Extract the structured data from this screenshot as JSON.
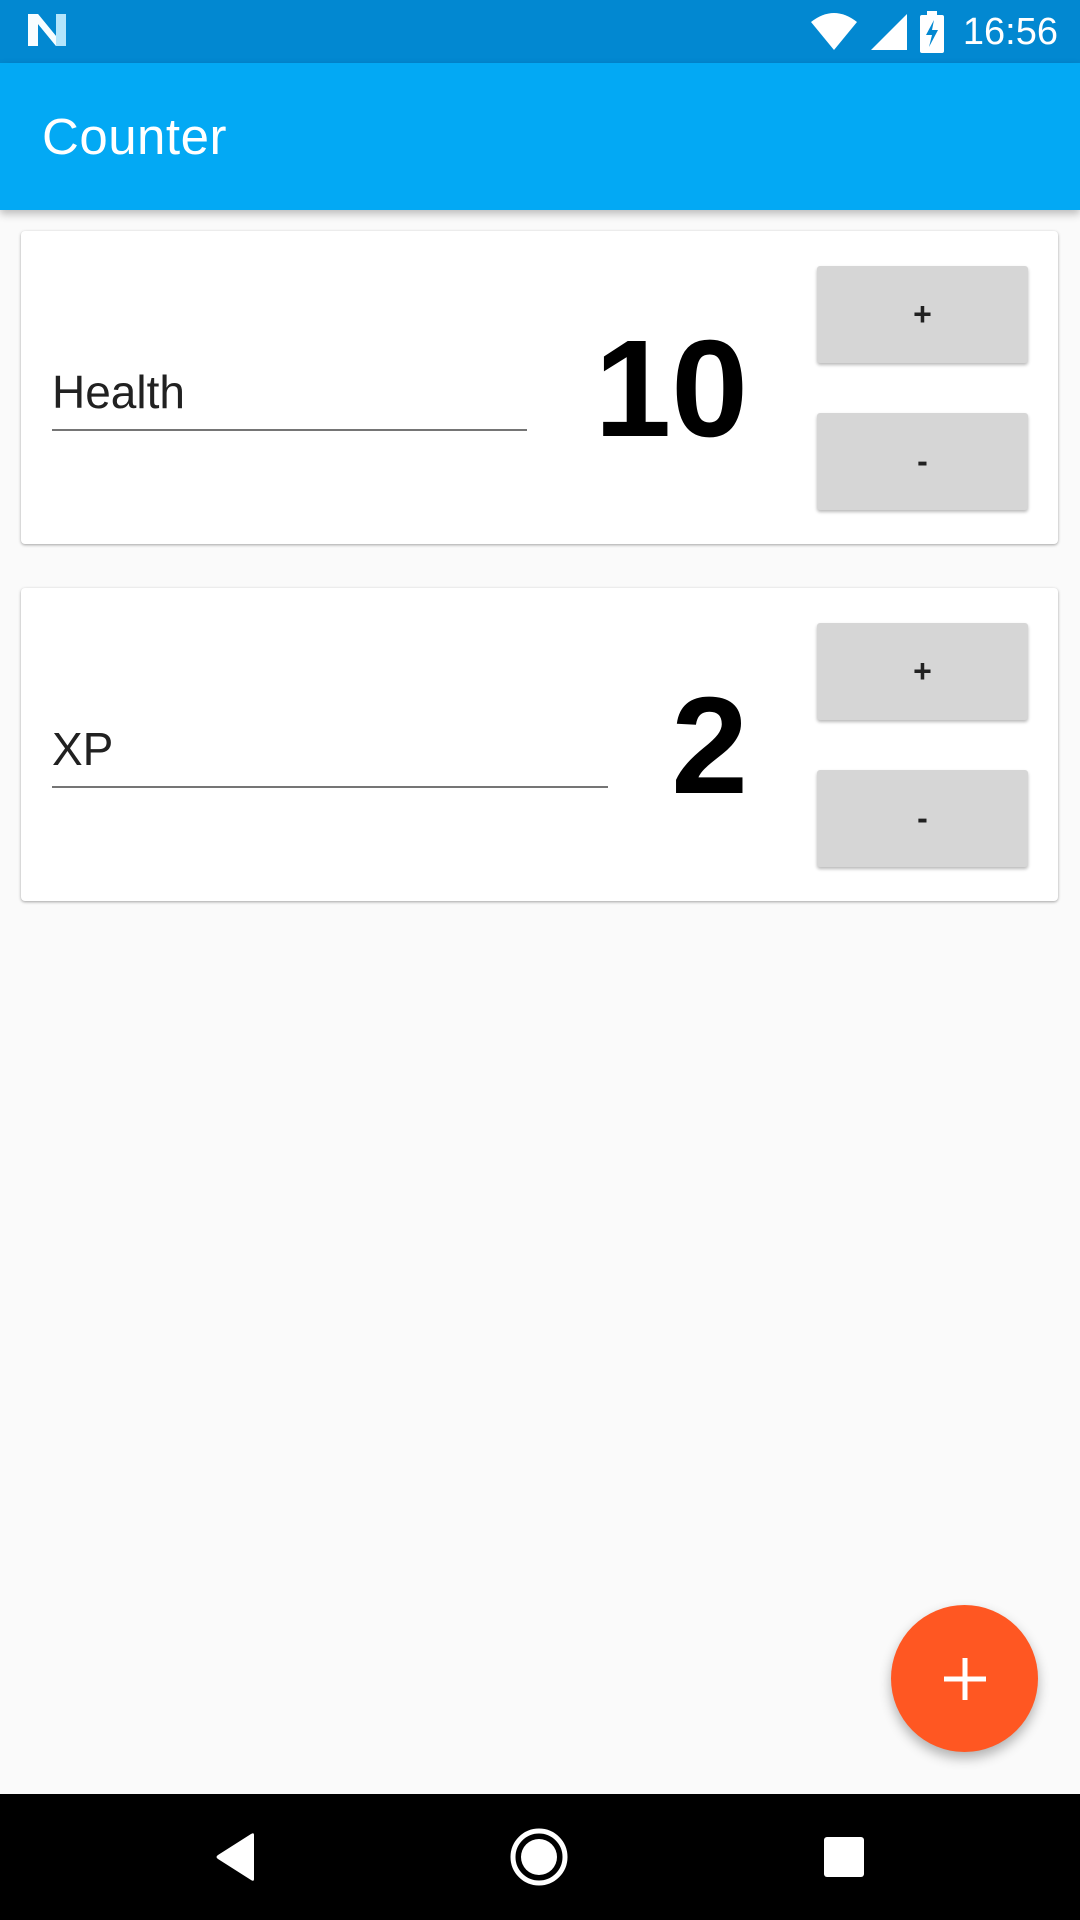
{
  "status_bar": {
    "time": "16:56",
    "left_icon": "notification-n-icon",
    "icons": [
      "wifi-icon",
      "signal-icon",
      "battery-charging-icon"
    ]
  },
  "app_bar": {
    "title": "Counter",
    "color": "#03A9F4",
    "status_color": "#0288D1"
  },
  "counters": [
    {
      "name": "Health",
      "value": "10",
      "increment_label": "+",
      "decrement_label": "-"
    },
    {
      "name": "XP",
      "value": "2",
      "increment_label": "+",
      "decrement_label": "-"
    }
  ],
  "fab": {
    "icon": "plus-icon",
    "color": "#FF5722"
  },
  "nav_bar": {
    "icons": [
      "back-icon",
      "home-icon",
      "recents-icon"
    ]
  }
}
